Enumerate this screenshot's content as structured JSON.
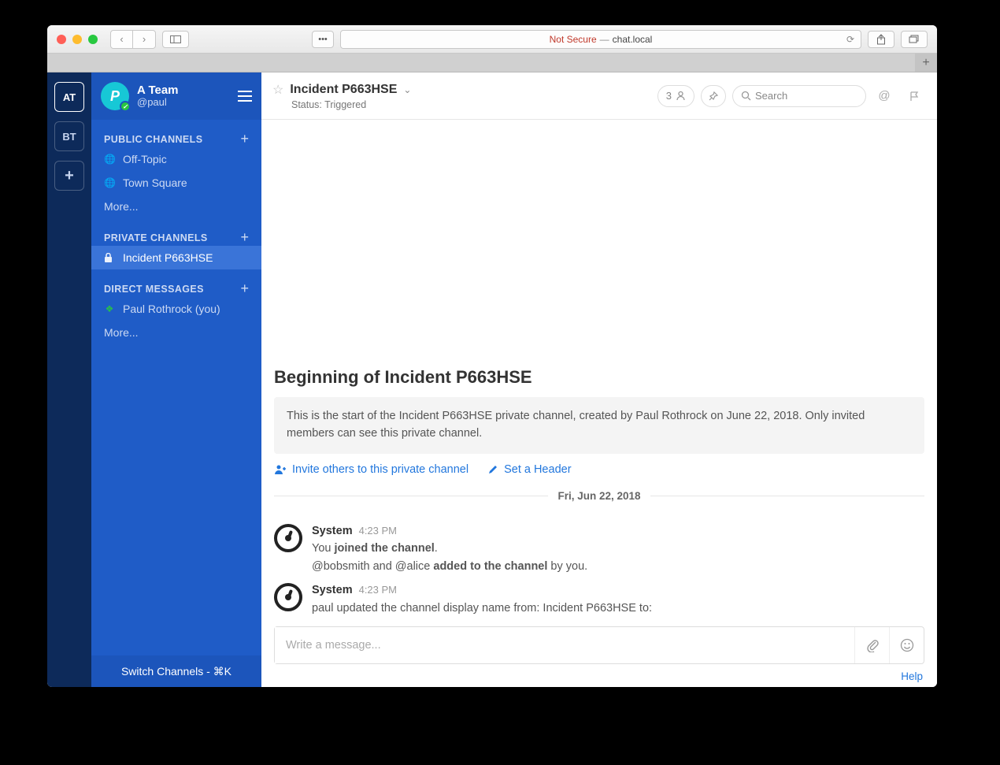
{
  "browser": {
    "not_secure": "Not Secure",
    "dash": "—",
    "host": "chat.local"
  },
  "team_rail": {
    "items": [
      "AT",
      "BT"
    ],
    "add": "+"
  },
  "sidebar": {
    "team_name": "A Team",
    "username": "@paul",
    "avatar_letter": "P",
    "sections": {
      "public_title": "PUBLIC CHANNELS",
      "private_title": "PRIVATE CHANNELS",
      "dm_title": "DIRECT MESSAGES"
    },
    "public_channels": [
      {
        "name": "Off-Topic"
      },
      {
        "name": "Town Square"
      }
    ],
    "more": "More...",
    "private_channels": [
      {
        "name": "Incident P663HSE"
      }
    ],
    "dms": [
      {
        "name": "Paul Rothrock (you)"
      }
    ],
    "switch": "Switch Channels - ⌘K"
  },
  "header": {
    "title": "Incident P663HSE",
    "status": "Status: Triggered",
    "member_count": "3",
    "search_placeholder": "Search"
  },
  "intro": {
    "heading": "Beginning of Incident P663HSE",
    "body": "This is the start of the Incident P663HSE private channel, created by Paul Rothrock on June 22, 2018. Only invited members can see this private channel.",
    "invite": "Invite others to this private channel",
    "set_header": "Set a Header"
  },
  "date": "Fri, Jun 22, 2018",
  "posts": [
    {
      "author": "System",
      "time": "4:23 PM",
      "line1_a": "You ",
      "line1_b": "joined the channel",
      "line1_c": ".",
      "line2_a": "@bobsmith and @alice ",
      "line2_b": "added to the channel",
      "line2_c": " by you."
    },
    {
      "author": "System",
      "time": "4:23 PM",
      "line1": "paul updated the channel display name from: Incident P663HSE to:"
    }
  ],
  "composer": {
    "placeholder": "Write a message..."
  },
  "help": "Help"
}
